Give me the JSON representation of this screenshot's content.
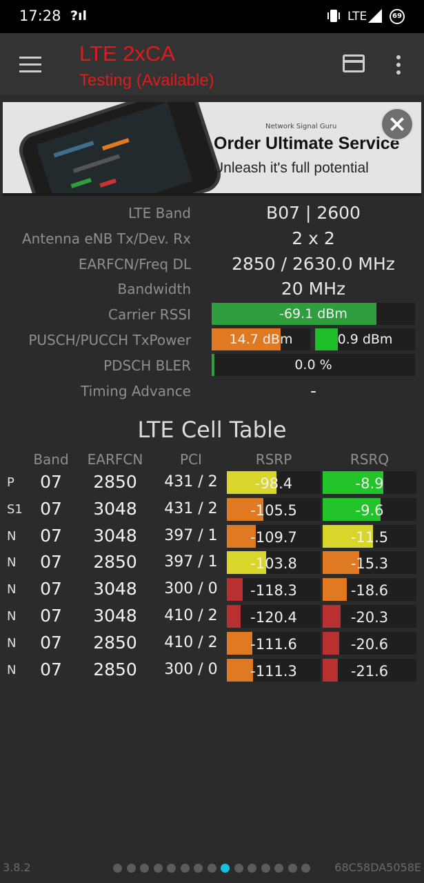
{
  "status_bar": {
    "time": "17:28",
    "signal_glyph": "?ıl",
    "network": "LTE",
    "battery": "69"
  },
  "app_bar": {
    "title": "LTE 2xCA",
    "subtitle": "Testing (Available)"
  },
  "ad": {
    "brand": "Network Signal Guru",
    "headline": "Order Ultimate Service",
    "tagline": "Unleash it's full potential"
  },
  "info": [
    {
      "label": "LTE Band",
      "value": "B07 | 2600"
    },
    {
      "label": "Antenna eNB Tx/Dev. Rx",
      "value": "2 x 2"
    },
    {
      "label": "EARFCN/Freq DL",
      "value": "2850 / 2630.0 MHz"
    },
    {
      "label": "Bandwidth",
      "value": "20 MHz"
    },
    {
      "label": "Carrier RSSI",
      "value": "-69.1 dBm",
      "fill": 0.81,
      "color": "#2e9e3f"
    },
    {
      "label": "PUSCH/PUCCH TxPower",
      "pusch": "14.7 dBm",
      "pusch_fill": 0.7,
      "pucch": "0.9 dBm",
      "pucch_fill": 0.23,
      "color_pusch": "#e07a22",
      "color_pucch": "#1fbf2a"
    },
    {
      "label": "PDSCH BLER",
      "value": "0.0 %",
      "fill": 0.015,
      "color": "#2e9e3f"
    },
    {
      "label": "Timing Advance",
      "value": "-"
    }
  ],
  "cell_table": {
    "title": "LTE Cell Table",
    "headers": {
      "band": "Band",
      "earfcn": "EARFCN",
      "pci": "PCI",
      "rsrp": "RSRP",
      "rsrq": "RSRQ"
    },
    "rows": [
      {
        "type": "P",
        "band": "07",
        "earfcn": "2850",
        "pci": "431 / 2",
        "rsrp": "-98.4",
        "rsrp_fill": 0.53,
        "rsrp_color": "#d8d62a",
        "rsrq": "-8.9",
        "rsrq_fill": 0.65,
        "rsrq_color": "#22c42a"
      },
      {
        "type": "S1",
        "band": "07",
        "earfcn": "3048",
        "pci": "431 / 2",
        "rsrp": "-105.5",
        "rsrp_fill": 0.39,
        "rsrp_color": "#e07a22",
        "rsrq": "-9.6",
        "rsrq_fill": 0.62,
        "rsrq_color": "#22c42a"
      },
      {
        "type": "N",
        "band": "07",
        "earfcn": "3048",
        "pci": "397 / 1",
        "rsrp": "-109.7",
        "rsrp_fill": 0.31,
        "rsrp_color": "#e07a22",
        "rsrq": "-11.5",
        "rsrq_fill": 0.54,
        "rsrq_color": "#d8d62a"
      },
      {
        "type": "N",
        "band": "07",
        "earfcn": "2850",
        "pci": "397 / 1",
        "rsrp": "-103.8",
        "rsrp_fill": 0.42,
        "rsrp_color": "#d8d62a",
        "rsrq": "-15.3",
        "rsrq_fill": 0.39,
        "rsrq_color": "#e07a22"
      },
      {
        "type": "N",
        "band": "07",
        "earfcn": "3048",
        "pci": "300 / 0",
        "rsrp": "-118.3",
        "rsrp_fill": 0.17,
        "rsrp_color": "#b8302f",
        "rsrq": "-18.6",
        "rsrq_fill": 0.26,
        "rsrq_color": "#e07a22"
      },
      {
        "type": "N",
        "band": "07",
        "earfcn": "3048",
        "pci": "410 / 2",
        "rsrp": "-120.4",
        "rsrp_fill": 0.15,
        "rsrp_color": "#b8302f",
        "rsrq": "-20.3",
        "rsrq_fill": 0.19,
        "rsrq_color": "#b8302f"
      },
      {
        "type": "N",
        "band": "07",
        "earfcn": "2850",
        "pci": "410 / 2",
        "rsrp": "-111.6",
        "rsrp_fill": 0.27,
        "rsrp_color": "#e07a22",
        "rsrq": "-20.6",
        "rsrq_fill": 0.18,
        "rsrq_color": "#b8302f"
      },
      {
        "type": "N",
        "band": "07",
        "earfcn": "2850",
        "pci": "300 / 0",
        "rsrp": "-111.3",
        "rsrp_fill": 0.28,
        "rsrp_color": "#e07a22",
        "rsrq": "-21.6",
        "rsrq_fill": 0.16,
        "rsrq_color": "#b8302f"
      }
    ]
  },
  "footer": {
    "version": "3.8.2",
    "serial": "68C58DA5058E",
    "page_count": 15,
    "active_page": 9
  }
}
